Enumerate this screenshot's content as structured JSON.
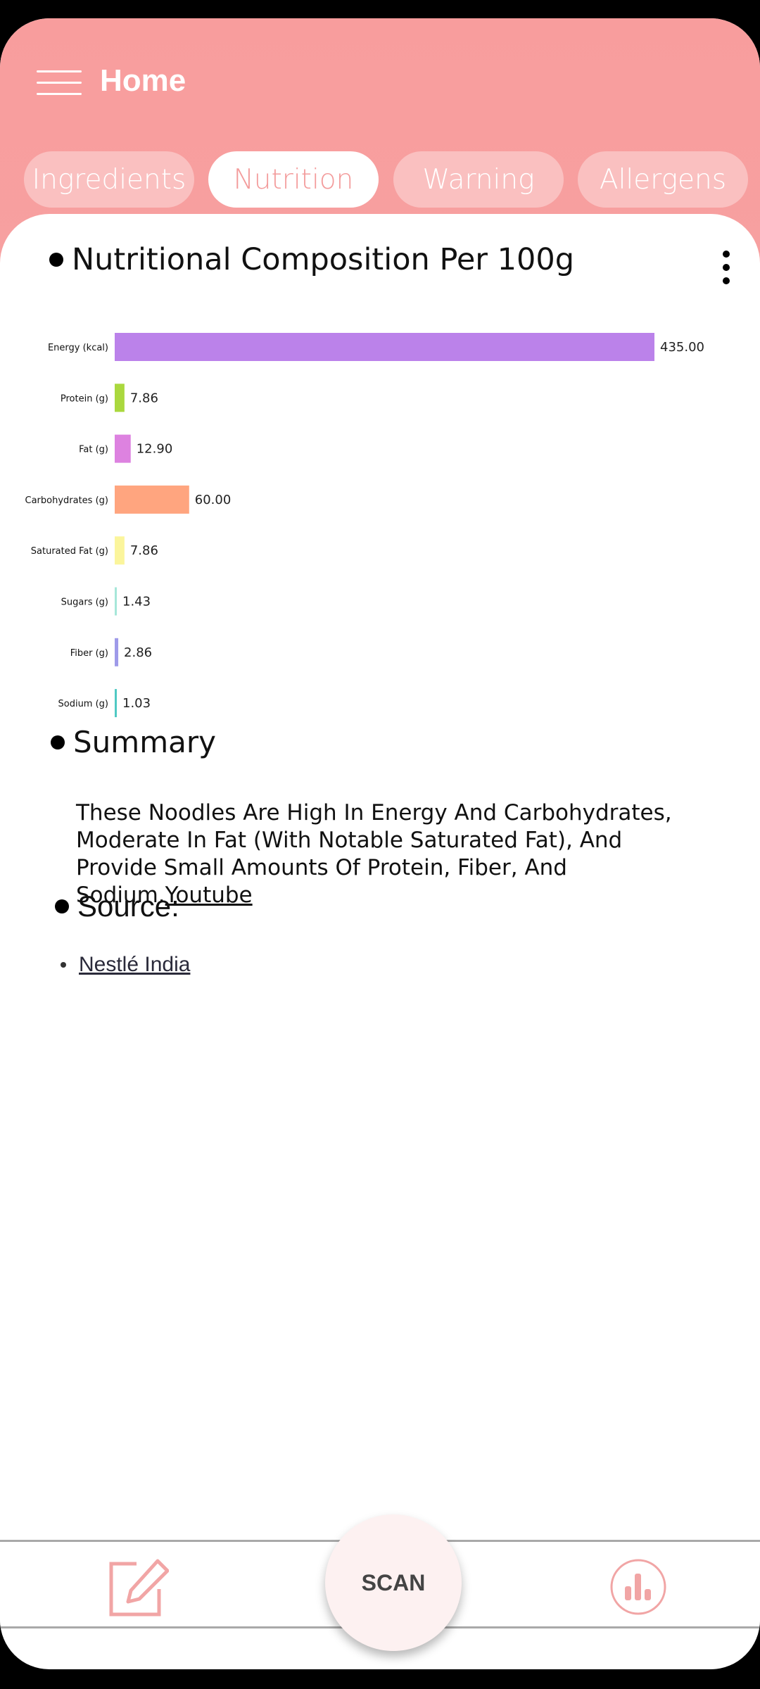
{
  "header": {
    "title": "Home",
    "menu_icon": "hamburger-menu-icon"
  },
  "tabs": [
    {
      "label": "Ingredients",
      "active": false
    },
    {
      "label": "Nutrition",
      "active": true
    },
    {
      "label": "Warning",
      "active": false
    },
    {
      "label": "Allergens",
      "active": false
    }
  ],
  "section": {
    "title": "Nutritional Composition Per 100g",
    "menu_icon": "more-vertical-icon"
  },
  "chart_data": {
    "type": "bar",
    "orientation": "horizontal",
    "categories": [
      "Energy (kcal)",
      "Protein (g)",
      "Fat (g)",
      "Carbohydrates (g)",
      "Saturated Fat (g)",
      "Sugars (g)",
      "Fiber (g)",
      "Sodium (g)"
    ],
    "values": [
      435.0,
      7.86,
      12.9,
      60.0,
      7.86,
      1.43,
      2.86,
      1.03
    ],
    "value_labels": [
      "435.00",
      "7.86",
      "12.90",
      "60.00",
      "7.86",
      "1.43",
      "2.86",
      "1.03"
    ],
    "colors": [
      "#bb82ea",
      "#aad83e",
      "#dd82e0",
      "#ffa57f",
      "#fbf59c",
      "#a6e7d9",
      "#9e9ae9",
      "#4fc9c3"
    ],
    "xlim": [
      0,
      435
    ]
  },
  "summary": {
    "title": "Summary",
    "text": "These Noodles Are High In Energy And Carbohydrates, Moderate In Fat (With Notable Saturated Fat), And Provide Small Amounts Of Protein, Fiber, And Sodium.",
    "link_label": "Youtube"
  },
  "source": {
    "title": "Source:",
    "items": [
      "Nestlé India"
    ]
  },
  "bottom_nav": {
    "left_icon": "edit-icon",
    "scan_label": "SCAN",
    "right_icon": "bar-chart-icon"
  },
  "colors": {
    "header": "#f89d9d",
    "accent": "#f39b9b"
  }
}
